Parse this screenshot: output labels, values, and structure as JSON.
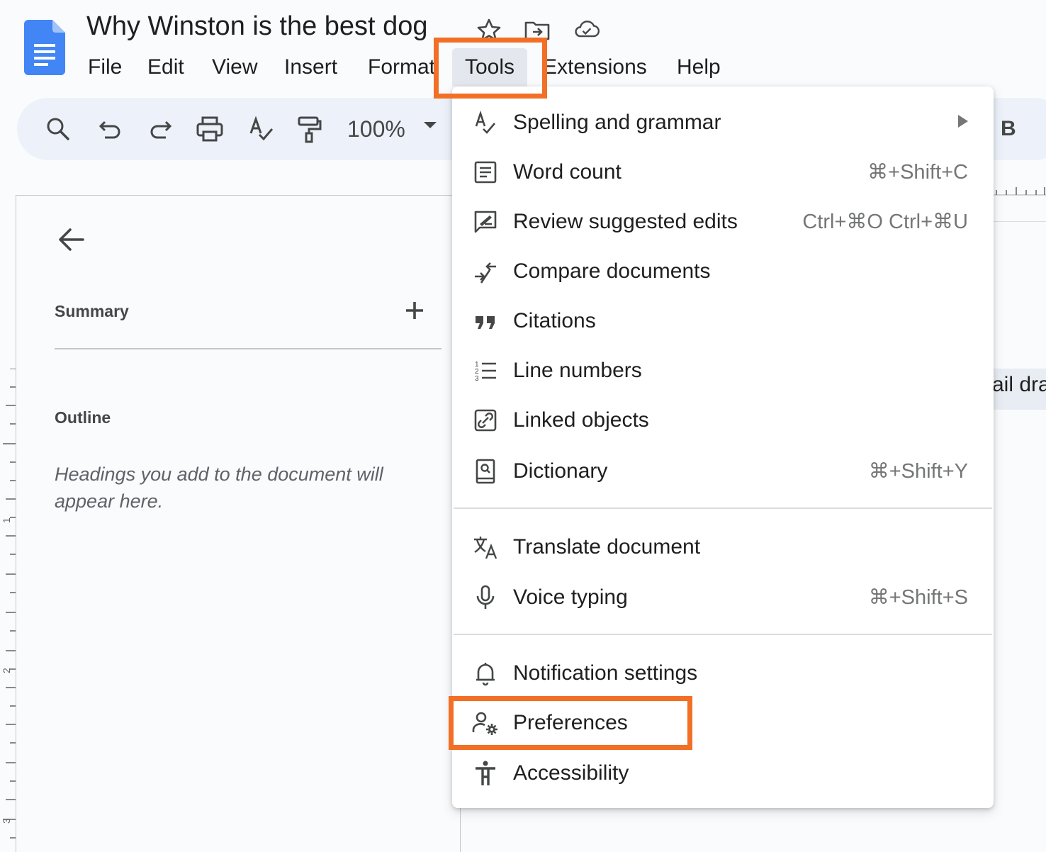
{
  "document": {
    "title": "Why Winston is the best dog"
  },
  "menubar": {
    "items": [
      "File",
      "Edit",
      "View",
      "Insert",
      "Format",
      "Tools",
      "Extensions",
      "Help"
    ],
    "active": "Tools"
  },
  "toolbar": {
    "zoom": "100%",
    "bold_label": "B",
    "icons": [
      "search-icon",
      "undo-icon",
      "redo-icon",
      "print-icon",
      "spellcheck-icon",
      "paint-format-icon",
      "bold-icon"
    ]
  },
  "side_panel": {
    "summary_label": "Summary",
    "outline_label": "Outline",
    "outline_hint": "Headings you add to the document will appear here."
  },
  "page": {
    "partial_text": "ail dra"
  },
  "ruler": {
    "labels": [
      "1",
      "2",
      "3"
    ]
  },
  "tools_menu": {
    "groups": [
      [
        {
          "label": "Spelling and grammar",
          "shortcut": "",
          "submenu": true,
          "icon": "spellcheck-icon"
        },
        {
          "label": "Word count",
          "shortcut": "⌘+Shift+C",
          "icon": "word-count-icon"
        },
        {
          "label": "Review suggested edits",
          "shortcut": "Ctrl+⌘O Ctrl+⌘U",
          "icon": "review-edits-icon"
        },
        {
          "label": "Compare documents",
          "shortcut": "",
          "icon": "compare-icon"
        },
        {
          "label": "Citations",
          "shortcut": "",
          "icon": "quote-icon"
        },
        {
          "label": "Line numbers",
          "shortcut": "",
          "icon": "line-numbers-icon"
        },
        {
          "label": "Linked objects",
          "shortcut": "",
          "icon": "linked-objects-icon"
        },
        {
          "label": "Dictionary",
          "shortcut": "⌘+Shift+Y",
          "icon": "dictionary-icon"
        }
      ],
      [
        {
          "label": "Translate document",
          "shortcut": "",
          "icon": "translate-icon"
        },
        {
          "label": "Voice typing",
          "shortcut": "⌘+Shift+S",
          "icon": "microphone-icon"
        }
      ],
      [
        {
          "label": "Notification settings",
          "shortcut": "",
          "icon": "bell-icon"
        },
        {
          "label": "Preferences",
          "shortcut": "",
          "icon": "preferences-icon"
        },
        {
          "label": "Accessibility",
          "shortcut": "",
          "icon": "accessibility-icon"
        }
      ]
    ]
  },
  "colors": {
    "highlight": "#f26f26",
    "docs_blue": "#4285f4",
    "toolbar_bg": "#edf2fa"
  }
}
